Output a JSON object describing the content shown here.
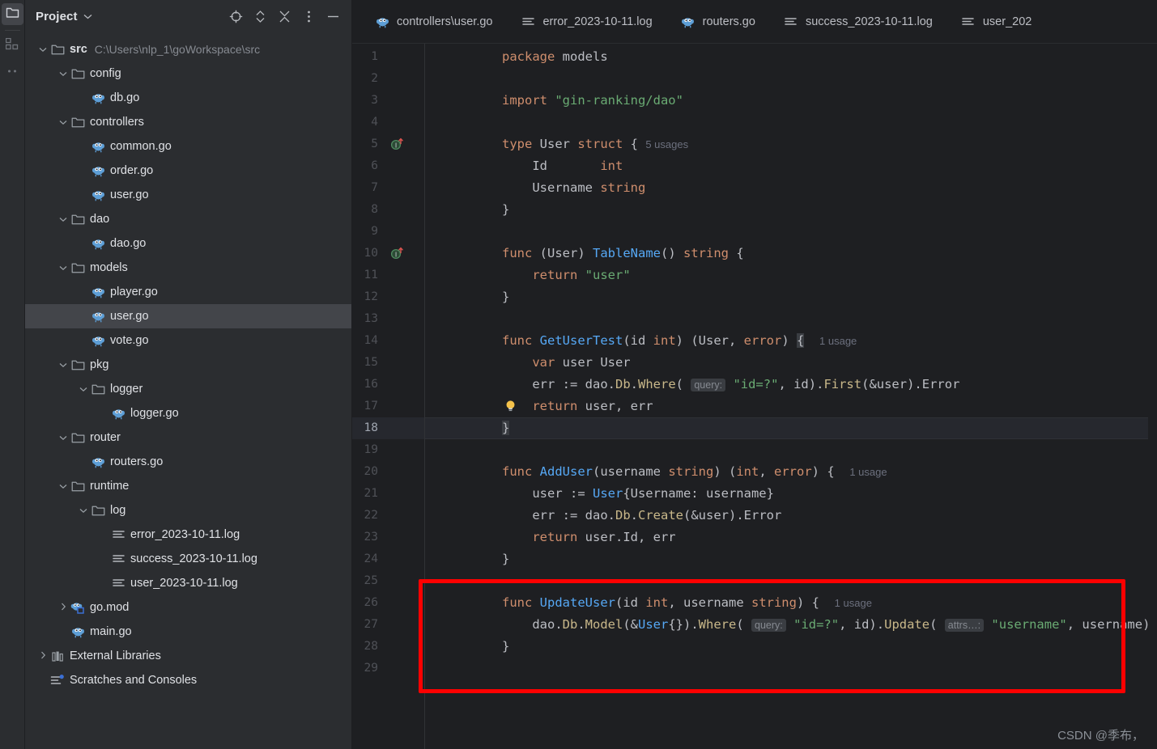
{
  "rail": {
    "items": [
      {
        "name": "project-folder-icon",
        "label": "Project",
        "active": true
      },
      {
        "name": "structure-icon",
        "label": "Structure",
        "active": false
      },
      {
        "name": "more-tool-windows-icon",
        "label": "More Tool Windows",
        "active": false
      }
    ]
  },
  "project_panel": {
    "title": "Project",
    "tools": [
      {
        "name": "select-opened-file-icon",
        "label": "Select Opened File"
      },
      {
        "name": "expand-collapse-icon",
        "label": "Expand / Collapse"
      },
      {
        "name": "collapse-all-icon",
        "label": "Collapse All"
      },
      {
        "name": "options-menu-icon",
        "label": "Options"
      },
      {
        "name": "hide-panel-icon",
        "label": "Hide"
      }
    ],
    "tree": [
      {
        "depth": 0,
        "arrow": "down",
        "icon": "folder-icon",
        "label": "src",
        "bold": true,
        "sub": "C:\\Users\\nlp_1\\goWorkspace\\src",
        "selected": false
      },
      {
        "depth": 1,
        "arrow": "down",
        "icon": "folder-icon",
        "label": "config",
        "bold": false,
        "sub": "",
        "selected": false
      },
      {
        "depth": 2,
        "arrow": "none",
        "icon": "go-file-icon",
        "label": "db.go",
        "bold": false,
        "sub": "",
        "selected": false
      },
      {
        "depth": 1,
        "arrow": "down",
        "icon": "folder-icon",
        "label": "controllers",
        "bold": false,
        "sub": "",
        "selected": false
      },
      {
        "depth": 2,
        "arrow": "none",
        "icon": "go-file-icon",
        "label": "common.go",
        "bold": false,
        "sub": "",
        "selected": false
      },
      {
        "depth": 2,
        "arrow": "none",
        "icon": "go-file-icon",
        "label": "order.go",
        "bold": false,
        "sub": "",
        "selected": false
      },
      {
        "depth": 2,
        "arrow": "none",
        "icon": "go-file-icon",
        "label": "user.go",
        "bold": false,
        "sub": "",
        "selected": false
      },
      {
        "depth": 1,
        "arrow": "down",
        "icon": "folder-icon",
        "label": "dao",
        "bold": false,
        "sub": "",
        "selected": false
      },
      {
        "depth": 2,
        "arrow": "none",
        "icon": "go-file-icon",
        "label": "dao.go",
        "bold": false,
        "sub": "",
        "selected": false
      },
      {
        "depth": 1,
        "arrow": "down",
        "icon": "folder-icon",
        "label": "models",
        "bold": false,
        "sub": "",
        "selected": false
      },
      {
        "depth": 2,
        "arrow": "none",
        "icon": "go-file-icon",
        "label": "player.go",
        "bold": false,
        "sub": "",
        "selected": false
      },
      {
        "depth": 2,
        "arrow": "none",
        "icon": "go-file-icon",
        "label": "user.go",
        "bold": false,
        "sub": "",
        "selected": true
      },
      {
        "depth": 2,
        "arrow": "none",
        "icon": "go-file-icon",
        "label": "vote.go",
        "bold": false,
        "sub": "",
        "selected": false
      },
      {
        "depth": 1,
        "arrow": "down",
        "icon": "folder-icon",
        "label": "pkg",
        "bold": false,
        "sub": "",
        "selected": false
      },
      {
        "depth": 2,
        "arrow": "down",
        "icon": "folder-icon",
        "label": "logger",
        "bold": false,
        "sub": "",
        "selected": false
      },
      {
        "depth": 3,
        "arrow": "none",
        "icon": "go-file-icon",
        "label": "logger.go",
        "bold": false,
        "sub": "",
        "selected": false
      },
      {
        "depth": 1,
        "arrow": "down",
        "icon": "folder-icon",
        "label": "router",
        "bold": false,
        "sub": "",
        "selected": false
      },
      {
        "depth": 2,
        "arrow": "none",
        "icon": "go-file-icon",
        "label": "routers.go",
        "bold": false,
        "sub": "",
        "selected": false
      },
      {
        "depth": 1,
        "arrow": "down",
        "icon": "folder-icon",
        "label": "runtime",
        "bold": false,
        "sub": "",
        "selected": false
      },
      {
        "depth": 2,
        "arrow": "down",
        "icon": "folder-icon",
        "label": "log",
        "bold": false,
        "sub": "",
        "selected": false
      },
      {
        "depth": 3,
        "arrow": "none",
        "icon": "log-file-icon",
        "label": "error_2023-10-11.log",
        "bold": false,
        "sub": "",
        "selected": false
      },
      {
        "depth": 3,
        "arrow": "none",
        "icon": "log-file-icon",
        "label": "success_2023-10-11.log",
        "bold": false,
        "sub": "",
        "selected": false
      },
      {
        "depth": 3,
        "arrow": "none",
        "icon": "log-file-icon",
        "label": "user_2023-10-11.log",
        "bold": false,
        "sub": "",
        "selected": false
      },
      {
        "depth": 1,
        "arrow": "right",
        "icon": "go-mod-icon",
        "label": "go.mod",
        "bold": false,
        "sub": "",
        "selected": false
      },
      {
        "depth": 1,
        "arrow": "none",
        "icon": "go-file-icon",
        "label": "main.go",
        "bold": false,
        "sub": "",
        "selected": false
      },
      {
        "depth": 0,
        "arrow": "right",
        "icon": "library-icon",
        "label": "External Libraries",
        "bold": false,
        "sub": "",
        "selected": false
      },
      {
        "depth": 0,
        "arrow": "none",
        "icon": "scratches-icon",
        "label": "Scratches and Consoles",
        "bold": false,
        "sub": "",
        "selected": false
      }
    ]
  },
  "tabs": [
    {
      "label": "controllers\\user.go",
      "icon": "go-file-icon",
      "active": false
    },
    {
      "label": "error_2023-10-11.log",
      "icon": "log-file-icon",
      "active": false
    },
    {
      "label": "routers.go",
      "icon": "go-file-icon",
      "active": false
    },
    {
      "label": "success_2023-10-11.log",
      "icon": "log-file-icon",
      "active": false
    },
    {
      "label": "user_202",
      "icon": "log-file-icon",
      "active": false
    }
  ],
  "editor": {
    "current_line": 18,
    "gutter_icons": [
      {
        "line": 5,
        "name": "implementing-interface-icon"
      },
      {
        "line": 10,
        "name": "implementing-interface-icon"
      }
    ],
    "intention_bulb_line": 17,
    "lines": [
      {
        "n": 1,
        "tokens": [
          {
            "t": "package ",
            "c": "kw"
          },
          {
            "t": "models",
            "c": "id"
          }
        ]
      },
      {
        "n": 2,
        "tokens": []
      },
      {
        "n": 3,
        "tokens": [
          {
            "t": "import ",
            "c": "kw"
          },
          {
            "t": "\"gin-ranking/dao\"",
            "c": "str"
          }
        ]
      },
      {
        "n": 4,
        "tokens": []
      },
      {
        "n": 5,
        "tokens": [
          {
            "t": "type ",
            "c": "kw"
          },
          {
            "t": "User ",
            "c": "id"
          },
          {
            "t": "struct",
            "c": "kw"
          },
          {
            "t": " { ",
            "c": "id"
          },
          {
            "t": "5 usages",
            "c": "usg"
          }
        ]
      },
      {
        "n": 6,
        "tokens": [
          {
            "t": "    Id       ",
            "c": "id"
          },
          {
            "t": "int",
            "c": "typ"
          }
        ]
      },
      {
        "n": 7,
        "tokens": [
          {
            "t": "    Username ",
            "c": "id"
          },
          {
            "t": "string",
            "c": "typ"
          }
        ]
      },
      {
        "n": 8,
        "tokens": [
          {
            "t": "}",
            "c": "id"
          }
        ]
      },
      {
        "n": 9,
        "tokens": []
      },
      {
        "n": 10,
        "tokens": [
          {
            "t": "func ",
            "c": "kw"
          },
          {
            "t": "(",
            "c": "id"
          },
          {
            "t": "User",
            "c": "id"
          },
          {
            "t": ") ",
            "c": "id"
          },
          {
            "t": "TableName",
            "c": "fn"
          },
          {
            "t": "() ",
            "c": "id"
          },
          {
            "t": "string",
            "c": "typ"
          },
          {
            "t": " {",
            "c": "id"
          }
        ]
      },
      {
        "n": 11,
        "tokens": [
          {
            "t": "    return ",
            "c": "kw"
          },
          {
            "t": "\"user\"",
            "c": "str"
          }
        ]
      },
      {
        "n": 12,
        "tokens": [
          {
            "t": "}",
            "c": "id"
          }
        ]
      },
      {
        "n": 13,
        "tokens": []
      },
      {
        "n": 14,
        "tokens": [
          {
            "t": "func ",
            "c": "kw"
          },
          {
            "t": "GetUserTest",
            "c": "fn"
          },
          {
            "t": "(id ",
            "c": "id"
          },
          {
            "t": "int",
            "c": "typ"
          },
          {
            "t": ") (User, ",
            "c": "id"
          },
          {
            "t": "error",
            "c": "typ"
          },
          {
            "t": ") ",
            "c": "id"
          },
          {
            "t": "{",
            "c": "brace-hl"
          },
          {
            "t": "  ",
            "c": "id"
          },
          {
            "t": "1 usage",
            "c": "usg"
          }
        ]
      },
      {
        "n": 15,
        "tokens": [
          {
            "t": "    var ",
            "c": "kw"
          },
          {
            "t": "user User",
            "c": "id"
          }
        ]
      },
      {
        "n": 16,
        "tokens": [
          {
            "t": "    err := dao.",
            "c": "id"
          },
          {
            "t": "Db",
            "c": "prop"
          },
          {
            "t": ".",
            "c": "id"
          },
          {
            "t": "Where",
            "c": "prop"
          },
          {
            "t": "( ",
            "c": "id"
          },
          {
            "t": "query:",
            "c": "hint"
          },
          {
            "t": " ",
            "c": "id"
          },
          {
            "t": "\"id=?\"",
            "c": "str"
          },
          {
            "t": ", id).",
            "c": "id"
          },
          {
            "t": "First",
            "c": "prop"
          },
          {
            "t": "(&user).",
            "c": "id"
          },
          {
            "t": "Error",
            "c": "id"
          }
        ]
      },
      {
        "n": 17,
        "tokens": [
          {
            "t": "    return ",
            "c": "kw"
          },
          {
            "t": "user, err",
            "c": "id"
          }
        ]
      },
      {
        "n": 18,
        "tokens": [
          {
            "t": "}",
            "c": "brace-hl"
          }
        ]
      },
      {
        "n": 19,
        "tokens": []
      },
      {
        "n": 20,
        "tokens": [
          {
            "t": "func ",
            "c": "kw"
          },
          {
            "t": "AddUser",
            "c": "fn"
          },
          {
            "t": "(username ",
            "c": "id"
          },
          {
            "t": "string",
            "c": "typ"
          },
          {
            "t": ") (",
            "c": "id"
          },
          {
            "t": "int",
            "c": "typ"
          },
          {
            "t": ", ",
            "c": "id"
          },
          {
            "t": "error",
            "c": "typ"
          },
          {
            "t": ") {  ",
            "c": "id"
          },
          {
            "t": "1 usage",
            "c": "usg"
          }
        ]
      },
      {
        "n": 21,
        "tokens": [
          {
            "t": "    user := ",
            "c": "id"
          },
          {
            "t": "User",
            "c": "fn"
          },
          {
            "t": "{Username: username}",
            "c": "id"
          }
        ]
      },
      {
        "n": 22,
        "tokens": [
          {
            "t": "    err := dao.",
            "c": "id"
          },
          {
            "t": "Db",
            "c": "prop"
          },
          {
            "t": ".",
            "c": "id"
          },
          {
            "t": "Create",
            "c": "prop"
          },
          {
            "t": "(&user).",
            "c": "id"
          },
          {
            "t": "Error",
            "c": "id"
          }
        ]
      },
      {
        "n": 23,
        "tokens": [
          {
            "t": "    return ",
            "c": "kw"
          },
          {
            "t": "user.Id, err",
            "c": "id"
          }
        ]
      },
      {
        "n": 24,
        "tokens": [
          {
            "t": "}",
            "c": "id"
          }
        ]
      },
      {
        "n": 25,
        "tokens": []
      },
      {
        "n": 26,
        "tokens": [
          {
            "t": "func ",
            "c": "kw"
          },
          {
            "t": "UpdateUser",
            "c": "fn"
          },
          {
            "t": "(id ",
            "c": "id"
          },
          {
            "t": "int",
            "c": "typ"
          },
          {
            "t": ", username ",
            "c": "id"
          },
          {
            "t": "string",
            "c": "typ"
          },
          {
            "t": ") {  ",
            "c": "id"
          },
          {
            "t": "1 usage",
            "c": "usg"
          }
        ]
      },
      {
        "n": 27,
        "tokens": [
          {
            "t": "    dao.",
            "c": "id"
          },
          {
            "t": "Db",
            "c": "prop"
          },
          {
            "t": ".",
            "c": "id"
          },
          {
            "t": "Model",
            "c": "prop"
          },
          {
            "t": "(&",
            "c": "id"
          },
          {
            "t": "User",
            "c": "fn"
          },
          {
            "t": "{}).",
            "c": "id"
          },
          {
            "t": "Where",
            "c": "prop"
          },
          {
            "t": "( ",
            "c": "id"
          },
          {
            "t": "query:",
            "c": "hint"
          },
          {
            "t": " ",
            "c": "id"
          },
          {
            "t": "\"id=?\"",
            "c": "str"
          },
          {
            "t": ", id).",
            "c": "id"
          },
          {
            "t": "Update",
            "c": "prop"
          },
          {
            "t": "( ",
            "c": "id"
          },
          {
            "t": "attrs…:",
            "c": "hint"
          },
          {
            "t": " ",
            "c": "id"
          },
          {
            "t": "\"username\"",
            "c": "str"
          },
          {
            "t": ", username)",
            "c": "id"
          }
        ]
      },
      {
        "n": 28,
        "tokens": [
          {
            "t": "}",
            "c": "id"
          }
        ]
      },
      {
        "n": 29,
        "tokens": []
      }
    ],
    "highlight_box": {
      "from_line": 25,
      "to_line": 29,
      "color": "#fe0000"
    }
  },
  "watermark": {
    "text": "CSDN @季布，"
  }
}
